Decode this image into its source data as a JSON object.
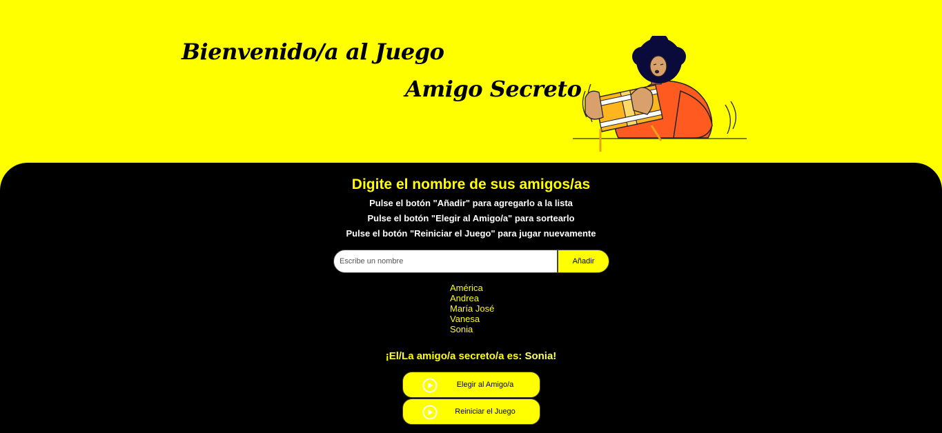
{
  "header": {
    "title_line1": "Bienvenido/a al Juego",
    "title_line2": "Amigo Secreto"
  },
  "main": {
    "heading": "Digite el nombre de sus amigos/as",
    "instructions": [
      "Pulse el botón \"Añadir\" para agregarlo a la lista",
      "Pulse el botón \"Elegir al Amigo/a\" para sortearlo",
      "Pulse el botón \"Reiniciar el Juego\" para jugar nuevamente"
    ],
    "input": {
      "placeholder": "Escribe un nombre",
      "value": ""
    },
    "add_label": "Añadir",
    "friends": [
      "América",
      "Andrea",
      "María José",
      "Vanesa",
      "Sonia"
    ],
    "result_prefix": "¡El/La amigo/a secreto/a es: ",
    "result_name": "Sonia!",
    "draw_label": "Elegir al Amigo/a",
    "reset_label": "Reiniciar el Juego"
  },
  "icons": {
    "play": "play-circle-icon"
  },
  "colors": {
    "accent": "#ffff00",
    "background": "#000000"
  }
}
